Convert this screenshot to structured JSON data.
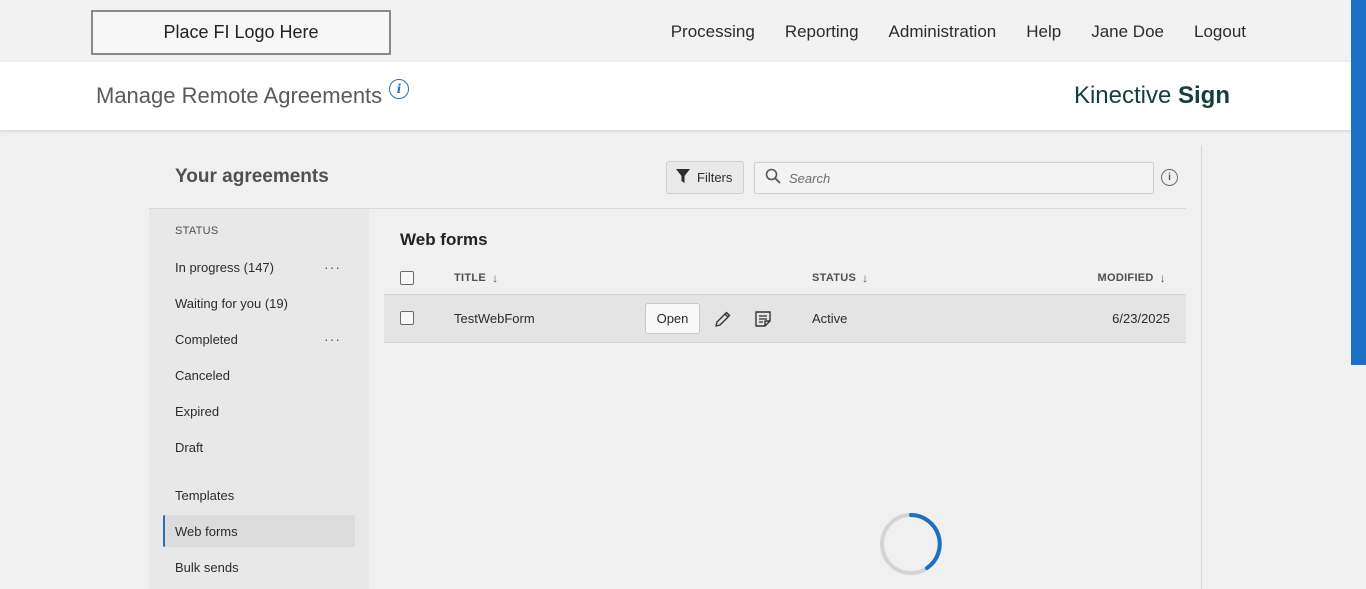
{
  "topbar": {
    "logo_text": "Place FI Logo Here",
    "nav": [
      "Processing",
      "Reporting",
      "Administration",
      "Help",
      "Jane Doe",
      "Logout"
    ]
  },
  "subheader": {
    "page_title": "Manage Remote Agreements",
    "info_glyph": "i",
    "brand_light": "Kinective",
    "brand_bold": "Sign"
  },
  "panel": {
    "title": "Your agreements",
    "filters_label": "Filters",
    "search_placeholder": "Search",
    "info_glyph": "i"
  },
  "sidebar": {
    "status_label": "STATUS",
    "status_items": [
      {
        "label": "In progress (147)",
        "has_more": true
      },
      {
        "label": "Waiting for you (19)",
        "has_more": false
      },
      {
        "label": "Completed",
        "has_more": true
      },
      {
        "label": "Canceled",
        "has_more": false
      },
      {
        "label": "Expired",
        "has_more": false
      },
      {
        "label": "Draft",
        "has_more": false
      }
    ],
    "other_items": [
      "Templates",
      "Web forms",
      "Bulk sends"
    ],
    "active_item": "Web forms",
    "more_glyph": "···"
  },
  "main": {
    "section_title": "Web forms",
    "columns": {
      "title": "TITLE",
      "status": "STATUS",
      "modified": "MODIFIED"
    },
    "sort_glyph": "↓",
    "rows": [
      {
        "title": "TestWebForm",
        "open_label": "Open",
        "status": "Active",
        "modified": "6/23/2025"
      }
    ]
  },
  "colors": {
    "accent_blue": "#2a6fb5",
    "scroll_accent": "#1c6fc4",
    "brand_teal": "#13403e"
  },
  "icons": [
    "info-icon",
    "filter-icon",
    "search-icon",
    "more-icon",
    "pencil-icon",
    "document-icon",
    "sort-arrow-icon",
    "loading-spinner-icon"
  ]
}
